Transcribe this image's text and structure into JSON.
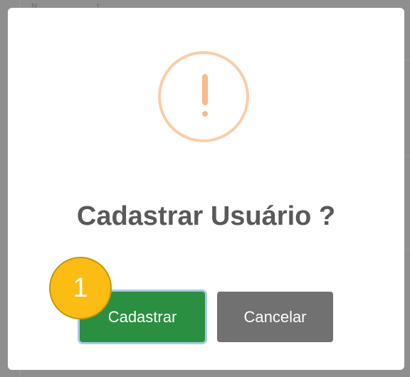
{
  "background": {
    "fragment_text": "N___ __ __ ___t_"
  },
  "dialog": {
    "icon": "exclamation-warning-icon",
    "title": "Cadastrar Usuário ?",
    "confirm_label": "Cadastrar",
    "cancel_label": "Cancelar"
  },
  "annotation": {
    "step_number": "1"
  },
  "colors": {
    "warning": "#f8bb86",
    "confirm": "#2a8f41",
    "cancel": "#717171",
    "badge": "#fbbd14"
  }
}
